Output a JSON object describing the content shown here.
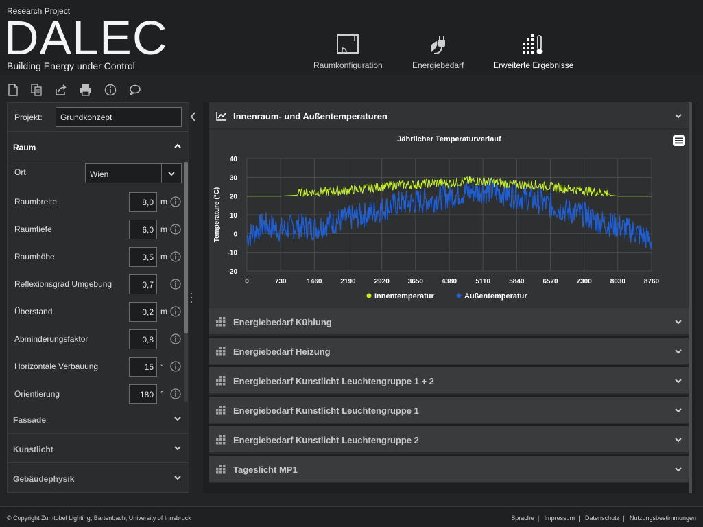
{
  "header": {
    "research": "Research Project",
    "logo": "DALEC",
    "tagline": "Building Energy under Control",
    "nav": [
      {
        "label": "Raumkonfiguration",
        "icon": "room-icon"
      },
      {
        "label": "Energiebedarf",
        "icon": "energy-plug-icon"
      },
      {
        "label": "Erweiterte Ergebnisse",
        "icon": "results-thermometer-icon"
      }
    ]
  },
  "toolbar": {
    "icons": [
      "new-document-icon",
      "copy-document-icon",
      "share-icon",
      "print-icon",
      "info-icon",
      "chat-icon"
    ]
  },
  "left": {
    "project_label": "Projekt:",
    "project_value": "Grundkonzept",
    "section_raum": "Raum",
    "ort_label": "Ort",
    "ort_value": "Wien",
    "params": [
      {
        "label": "Raumbreite",
        "value": "8,0",
        "unit": "m",
        "info": true
      },
      {
        "label": "Raumtiefe",
        "value": "6,0",
        "unit": "m",
        "info": true
      },
      {
        "label": "Raumhöhe",
        "value": "3,5",
        "unit": "m",
        "info": true
      },
      {
        "label": "Reflexionsgrad Umgebung",
        "value": "0,7",
        "unit": "",
        "info": true
      },
      {
        "label": "Überstand",
        "value": "0,2",
        "unit": "m",
        "info": true
      },
      {
        "label": "Abminderungsfaktor",
        "value": "0,8",
        "unit": "",
        "info": true
      },
      {
        "label": "Horizontale Verbauung",
        "value": "15",
        "unit": "°",
        "info": true
      },
      {
        "label": "Orientierung",
        "value": "180",
        "unit": "°",
        "info": true
      }
    ],
    "sections": [
      "Fassade",
      "Kunstlicht",
      "Gebäudephysik"
    ]
  },
  "right": {
    "chart_section": "Innenraum- und Außentemperaturen",
    "accordions": [
      "Energiebedarf Kühlung",
      "Energiebedarf Heizung",
      "Energiebedarf Kunstlicht Leuchtengruppe 1 + 2",
      "Energiebedarf Kunstlicht Leuchtengruppe 1",
      "Energiebedarf Kunstlicht Leuchtengruppe 2",
      "Tageslicht MP1"
    ]
  },
  "chart_data": {
    "type": "line",
    "title": "Jährlicher Temperaturverlauf",
    "xlabel": "",
    "ylabel": "Temperature (°C)",
    "xlim": [
      0,
      8760
    ],
    "ylim": [
      -20,
      40
    ],
    "xticks": [
      "0",
      "730",
      "1460",
      "2190",
      "2920",
      "3650",
      "4380",
      "5110",
      "5840",
      "6570",
      "7300",
      "8030",
      "8760"
    ],
    "yticks": [
      "40",
      "30",
      "20",
      "10",
      "0",
      "-10",
      "-20"
    ],
    "grid": true,
    "legend": "bottom",
    "series": [
      {
        "name": "Innentemperatur",
        "color": "#c6f22a",
        "x": [
          0,
          730,
          1460,
          2190,
          2920,
          3285,
          3650,
          4015,
          4380,
          4745,
          5110,
          5475,
          5840,
          6205,
          6570,
          6935,
          7300,
          8030,
          8760
        ],
        "y": [
          20,
          20,
          21,
          22,
          24,
          25,
          25,
          26,
          26,
          27,
          27,
          26,
          25,
          25,
          24,
          23,
          22,
          20,
          20
        ]
      },
      {
        "name": "Außentemperatur",
        "color": "#1f5fd6",
        "x": [
          0,
          365,
          730,
          1095,
          1460,
          1825,
          2190,
          2555,
          2920,
          3285,
          3650,
          4015,
          4380,
          4745,
          5110,
          5475,
          5840,
          6205,
          6570,
          6935,
          7300,
          7665,
          8030,
          8395,
          8760
        ],
        "y": [
          -2,
          5,
          2,
          4,
          3,
          6,
          8,
          10,
          13,
          16,
          17,
          18,
          20,
          22,
          23,
          22,
          20,
          18,
          15,
          12,
          10,
          6,
          4,
          1,
          -4
        ]
      }
    ]
  },
  "footer": {
    "copyright": "© Copyright Zumtobel Lighting, Bartenbach, University of Innsbruck",
    "links": [
      "Sprache",
      "Impressum",
      "Datenschutz",
      "Nutzungsbestimmungen"
    ]
  }
}
